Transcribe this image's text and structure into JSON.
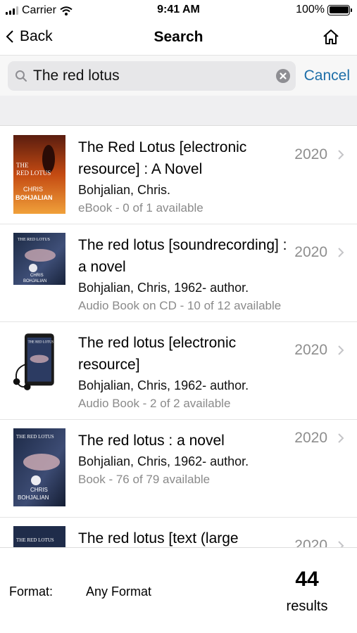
{
  "status_bar": {
    "carrier": "Carrier",
    "time": "9:41 AM",
    "battery": "100%"
  },
  "nav": {
    "back_label": "Back",
    "title": "Search"
  },
  "search": {
    "query": "The red lotus",
    "cancel_label": "Cancel"
  },
  "results": [
    {
      "title": "The Red Lotus [electronic resource] : A Novel",
      "author": "Bohjalian, Chris.",
      "availability": "eBook - 0 of 1 available",
      "year": "2020",
      "cover": "book-cover"
    },
    {
      "title": "The red lotus [soundrecording] : a novel",
      "author": "Bohjalian, Chris, 1962- author.",
      "availability": "Audio Book on CD - 10 of 12 available",
      "year": "2020",
      "cover": "cd-cover"
    },
    {
      "title": "The red lotus [electronic resource]",
      "author": "Bohjalian, Chris, 1962- author.",
      "availability": "Audio Book - 2 of 2 available",
      "year": "2020",
      "cover": "audio-player-cover"
    },
    {
      "title": "The red lotus : a novel",
      "author": "Bohjalian, Chris, 1962- author.",
      "availability": "Book - 76 of 79 available",
      "year": "2020",
      "cover": "book-cover"
    },
    {
      "title": "The red lotus [text (large",
      "author": "",
      "availability": "",
      "year": "2020",
      "cover": "book-cover"
    }
  ],
  "covers": {
    "book1": {
      "top": "THE",
      "title": "RED LOTUS",
      "author_first": "CHRIS",
      "author_last": "BOHJALIAN"
    },
    "cd": {
      "title": "THE RED LOTUS",
      "author_first": "CHRIS",
      "author_last": "BOHJALIAN"
    },
    "audio": {
      "title": "THE RED LOTUS"
    },
    "book4": {
      "title": "THE RED LOTUS",
      "author_first": "CHRIS",
      "author_last": "BOHJALIAN"
    },
    "book5": {
      "title": "THE RED LOTUS"
    }
  },
  "footer": {
    "format_label": "Format:",
    "format_value": "Any Format",
    "count": "44",
    "count_label": "results"
  },
  "colors": {
    "accent": "#1d6ea8",
    "secondary_text": "#8a8a8a",
    "band": "#efeff1"
  },
  "icons": [
    "signal-icon",
    "wifi-icon",
    "battery-icon",
    "back-chevron-icon",
    "home-icon",
    "search-icon",
    "clear-icon",
    "chevron-right-icon"
  ]
}
